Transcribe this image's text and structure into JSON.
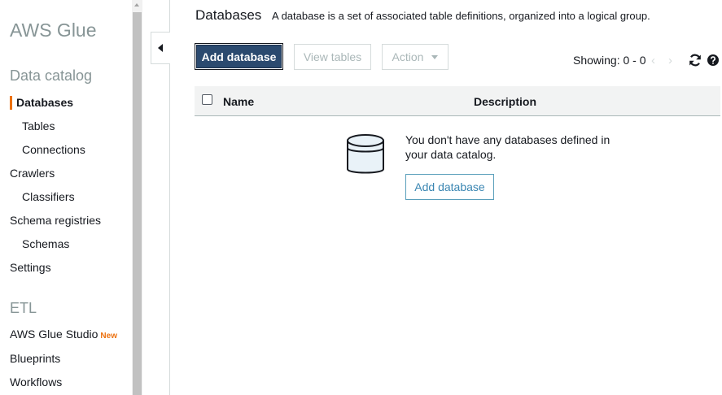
{
  "sidebar": {
    "app_title": "AWS Glue",
    "section_data_catalog": "Data catalog",
    "items": {
      "databases": "Databases",
      "tables": "Tables",
      "connections": "Connections",
      "crawlers": "Crawlers",
      "classifiers": "Classifiers",
      "schema_registries": "Schema registries",
      "schemas": "Schemas",
      "settings": "Settings"
    },
    "section_etl": "ETL",
    "etl_items": {
      "glue_studio": "AWS Glue Studio",
      "glue_studio_badge": "New",
      "blueprints": "Blueprints",
      "workflows": "Workflows"
    }
  },
  "header": {
    "title": "Databases",
    "description": "A database is a set of associated table definitions, organized into a logical group."
  },
  "toolbar": {
    "add_database": "Add database",
    "view_tables": "View tables",
    "action": "Action",
    "showing": "Showing: 0 - 0",
    "prev": "‹",
    "next": "›"
  },
  "table": {
    "columns": [
      "Name",
      "Description"
    ]
  },
  "empty_state": {
    "message": "You don't have any databases defined in your data catalog.",
    "button": "Add database"
  },
  "colors": {
    "accent": "#ec7211",
    "primary_button": "#2b4a6f",
    "link": "#3a86b2"
  }
}
